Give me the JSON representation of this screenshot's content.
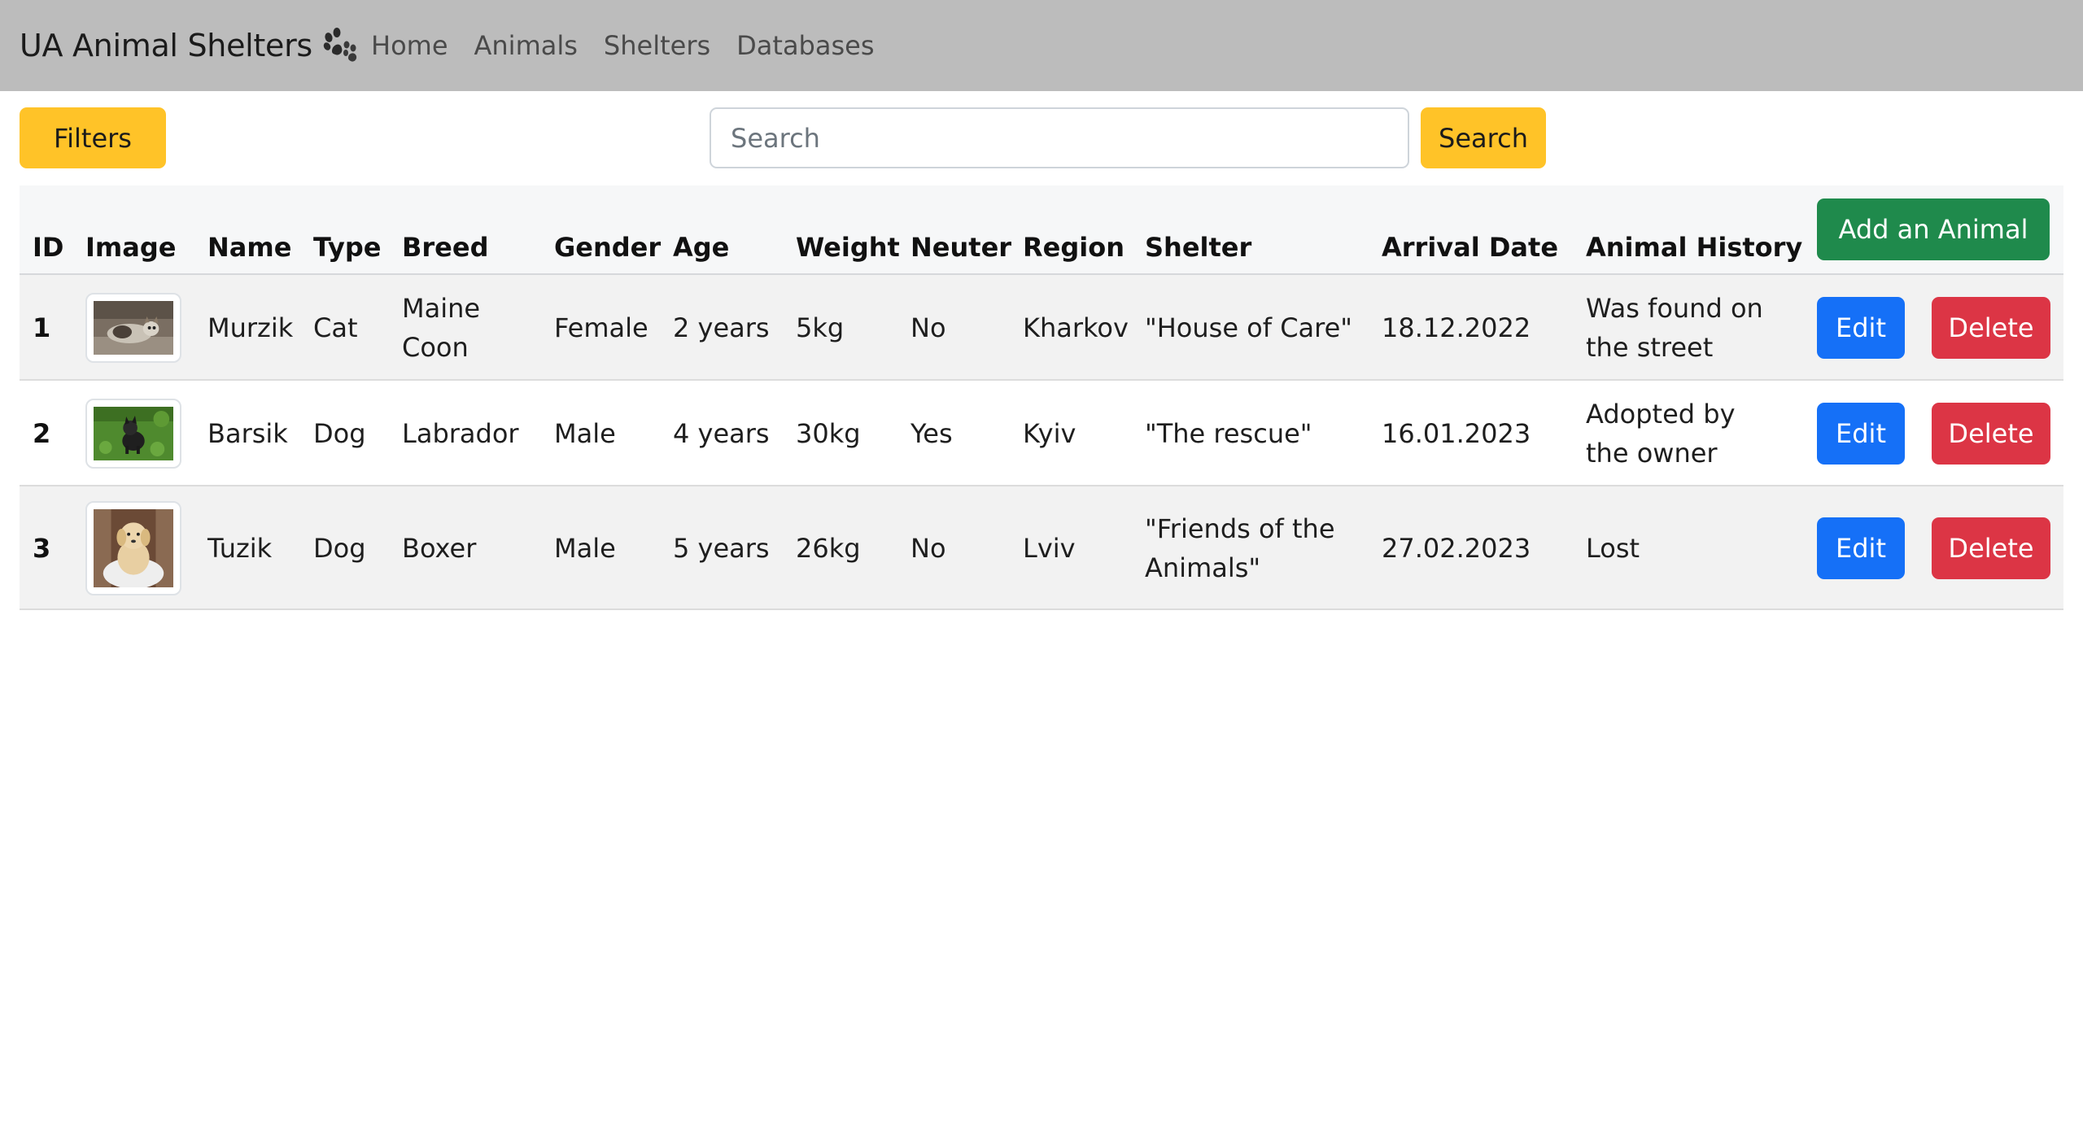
{
  "navbar": {
    "brand": "UA Animal Shelters",
    "brand_icon": "paw-icon",
    "links": [
      "Home",
      "Animals",
      "Shelters",
      "Databases"
    ]
  },
  "toolbar": {
    "filters_label": "Filters",
    "search_placeholder": "Search",
    "search_value": "",
    "search_label": "Search"
  },
  "table": {
    "headers": [
      "ID",
      "Image",
      "Name",
      "Type",
      "Breed",
      "Gender",
      "Age",
      "Weight",
      "Neuter",
      "Region",
      "Shelter",
      "Arrival Date",
      "Animal History"
    ],
    "add_label": "Add an Animal",
    "edit_label": "Edit",
    "delete_label": "Delete",
    "rows": [
      {
        "id": "1",
        "image": "cat-photo",
        "name": "Murzik",
        "type": "Cat",
        "breed": "Maine Coon",
        "gender": "Female",
        "age": "2 years",
        "weight": "5kg",
        "neuter": "No",
        "region": "Kharkov",
        "shelter": "\"House of Care\"",
        "arrival_date": "18.12.2022",
        "history": "Was found on the street"
      },
      {
        "id": "2",
        "image": "dog-on-grass-photo",
        "name": "Barsik",
        "type": "Dog",
        "breed": "Labrador",
        "gender": "Male",
        "age": "4 years",
        "weight": "30kg",
        "neuter": "Yes",
        "region": "Kyiv",
        "shelter": "\"The rescue\"",
        "arrival_date": "16.01.2023",
        "history": "Adopted by the owner"
      },
      {
        "id": "3",
        "image": "puppy-photo",
        "name": "Tuzik",
        "type": "Dog",
        "breed": "Boxer",
        "gender": "Male",
        "age": "5 years",
        "weight": "26kg",
        "neuter": "No",
        "region": "Lviv",
        "shelter": "\"Friends of the Animals\"",
        "arrival_date": "27.02.2023",
        "history": "Lost"
      }
    ]
  },
  "colors": {
    "navbar_bg": "#bcbcbc",
    "warning": "#ffc328",
    "success": "#1f8a4c",
    "primary": "#1570f7",
    "danger": "#dc3545"
  }
}
